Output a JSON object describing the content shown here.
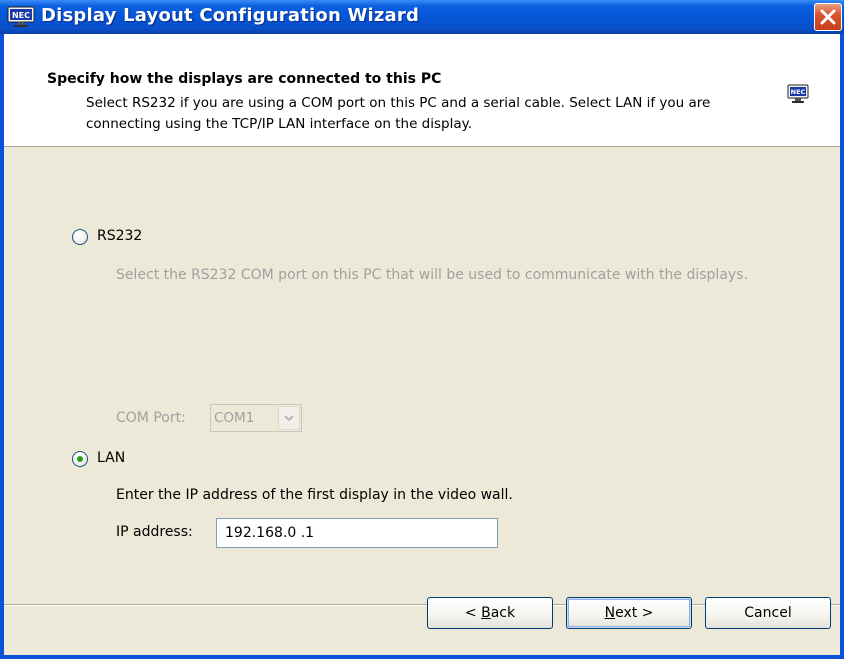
{
  "window": {
    "title": "Display Layout Configuration Wizard",
    "app_icon": "nec-monitor-icon",
    "titlebar_color": "#0a5fe0",
    "close_button_color": "#d8542c"
  },
  "header": {
    "title": "Specify how the displays are connected to this PC",
    "description": "Select RS232 if you are using a COM port on this PC and a serial cable. Select LAN if you are connecting using the TCP/IP LAN interface on the display.",
    "icon": "nec-monitor-icon"
  },
  "rs232": {
    "label": "RS232",
    "selected": false,
    "description": "Select the RS232 COM port on this PC that will be used to communicate with the displays.",
    "com_port_label": "COM Port:",
    "com_port_value": "COM1",
    "enabled": false
  },
  "lan": {
    "label": "LAN",
    "selected": true,
    "description": "Enter the IP address of the first display in the video wall.",
    "ip_label": "IP address:",
    "ip_value": "192.168.0 .1"
  },
  "buttons": {
    "back_label": "< Back",
    "back_mnemonic": "B",
    "next_label": "Next >",
    "next_mnemonic": "N",
    "cancel_label": "Cancel"
  }
}
